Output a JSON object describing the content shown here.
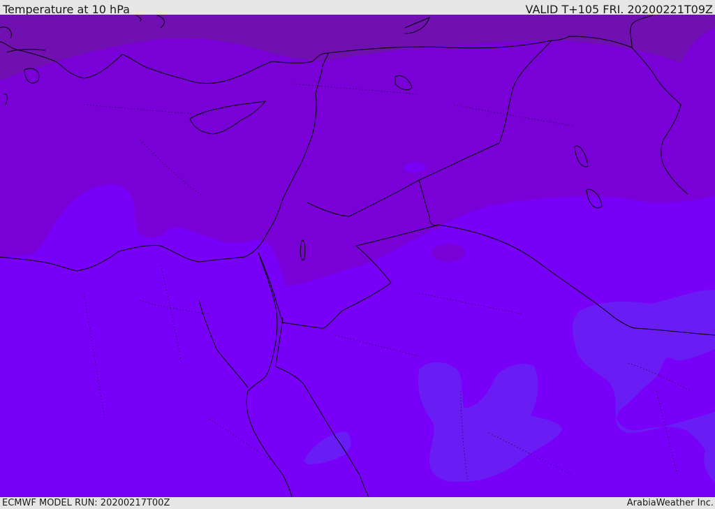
{
  "header": {
    "title": "Temperature at 10 hPa",
    "valid": "VALID T+105 FRI. 20200221T09Z"
  },
  "footer": {
    "model_run": "ECMWF MODEL RUN: 20200217T00Z",
    "credit": "ArabiaWeather Inc."
  },
  "colors": {
    "background": "#e6e6e6",
    "band_darkest": "#7010b0",
    "band_dark": "#7a00d8",
    "band_mid": "#7800f8",
    "band_light": "#6a1cf5",
    "coastline": "#000000"
  }
}
